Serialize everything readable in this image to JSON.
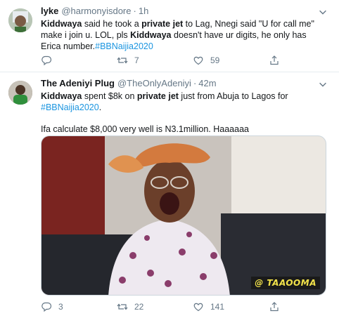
{
  "tweets": [
    {
      "name": "lyke",
      "handle": "@harmonyisdore",
      "time": "1h",
      "text_parts": {
        "a": "Kiddwaya",
        "b": " said he took a ",
        "c": "private jet",
        "d": " to Lag, Nnegi said \"U for call me\" make i join u. LOL, pls ",
        "e": "Kiddwaya",
        "f": " doesn't have ur digits, he only has Erica number.",
        "g": "#BBNaijia2020"
      },
      "replies": "",
      "retweets": "7",
      "likes": "59"
    },
    {
      "name": "The Adeniyi Plug",
      "handle": "@TheOnlyAdeniyi",
      "time": "42m",
      "text_parts": {
        "a": "Kiddwaya",
        "b": " spent $8k on ",
        "c": "private jet",
        "d": "  just from Abuja to Lagos for ",
        "e": "#BBNaijia2020",
        "f": ".",
        "g": "Ifa calculate $8,000 very well is N3.1million. Haaaaaa"
      },
      "watermark": "@ TAAOOMA",
      "replies": "3",
      "retweets": "22",
      "likes": "141"
    }
  ],
  "colors": {
    "link": "#1b95e0",
    "muted": "#657786",
    "text": "#14171a",
    "divider": "#e6ecf0"
  },
  "icons": [
    "reply-icon",
    "retweet-icon",
    "like-icon",
    "share-icon",
    "caret-down-icon"
  ]
}
